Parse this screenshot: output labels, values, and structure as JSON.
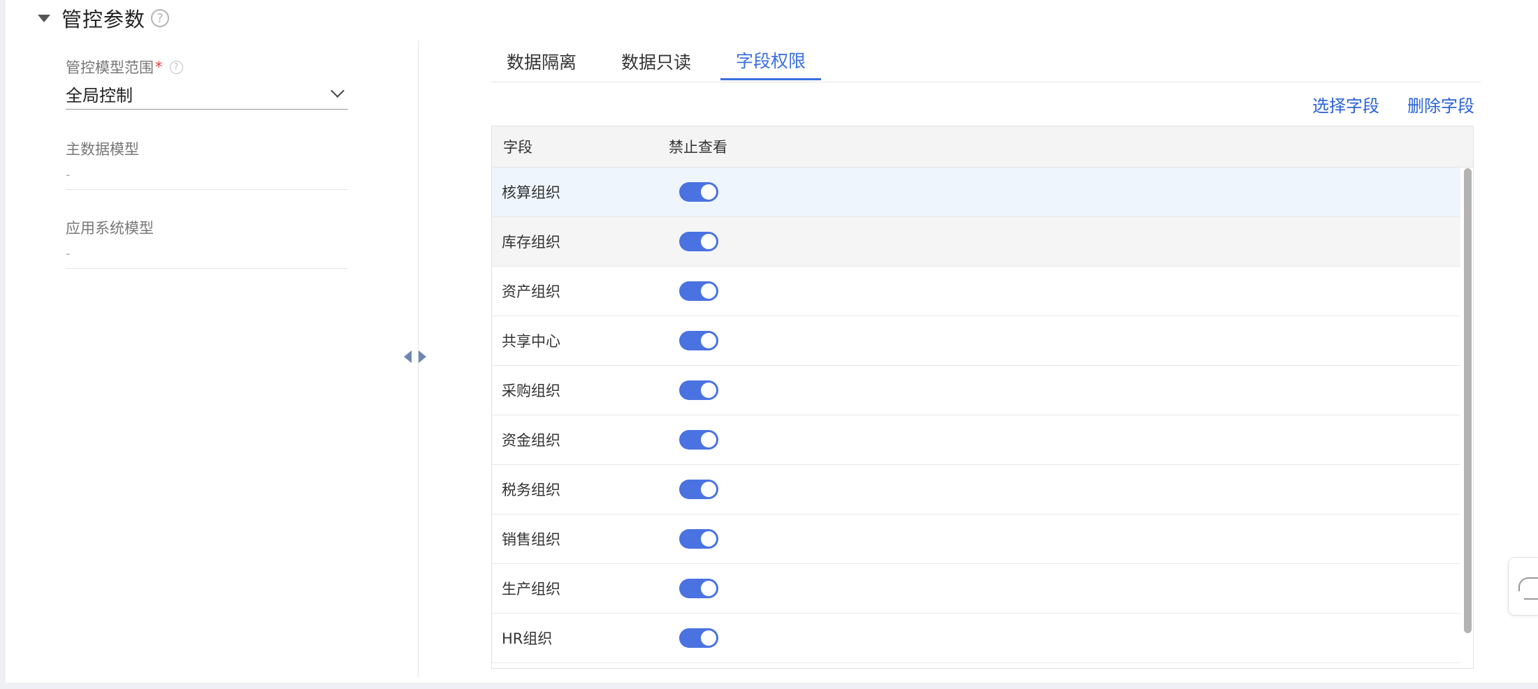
{
  "section": {
    "title": "管控参数",
    "help": "?"
  },
  "form": {
    "scope_label": "管控模型范围",
    "required_mark": "*",
    "help": "?",
    "scope_value": "全局控制",
    "master_model_label": "主数据模型",
    "master_model_value": "-",
    "app_model_label": "应用系统模型",
    "app_model_value": "-"
  },
  "tabs": [
    {
      "label": "数据隔离",
      "active": false
    },
    {
      "label": "数据只读",
      "active": false
    },
    {
      "label": "字段权限",
      "active": true
    }
  ],
  "actions": {
    "select_label": "选择字段",
    "delete_label": "删除字段"
  },
  "table": {
    "headers": {
      "field": "字段",
      "forbid_view": "禁止查看"
    },
    "rows": [
      {
        "name": "核算组织",
        "forbid_view": true
      },
      {
        "name": "库存组织",
        "forbid_view": true
      },
      {
        "name": "资产组织",
        "forbid_view": true
      },
      {
        "name": "共享中心",
        "forbid_view": true
      },
      {
        "name": "采购组织",
        "forbid_view": true
      },
      {
        "name": "资金组织",
        "forbid_view": true
      },
      {
        "name": "税务组织",
        "forbid_view": true
      },
      {
        "name": "销售组织",
        "forbid_view": true
      },
      {
        "name": "生产组织",
        "forbid_view": true
      },
      {
        "name": "HR组织",
        "forbid_view": true
      }
    ]
  },
  "colors": {
    "accent": "#3a6fe0",
    "toggle_on": "#4a72e0",
    "link": "#2a62d6"
  }
}
